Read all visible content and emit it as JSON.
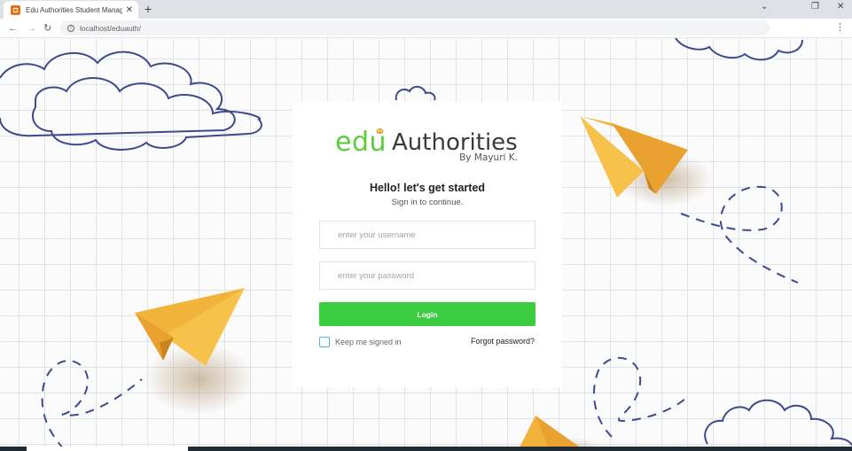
{
  "browser": {
    "tab_title": "Edu Authorities Student Manager",
    "url": "localhost/eduauth/",
    "new_tab_symbol": "+",
    "tab_close_symbol": "✕"
  },
  "brand": {
    "logo_edu": "edu",
    "logo_authorities": "Authorities",
    "logo_byline": "By Mayuri K.",
    "green": "#5dcc3a"
  },
  "login": {
    "heading": "Hello! let's get started",
    "subheading": "Sign in to continue.",
    "username_placeholder": "enter your username",
    "password_placeholder": "enter your password",
    "username_value": "",
    "password_value": "",
    "login_label": "Login",
    "remember_label": "Keep me signed in",
    "remember_checked": false,
    "forgot_label": "Forgot password?",
    "button_color": "#3ccc40"
  },
  "icons": {
    "back": "arrow-left-icon",
    "forward": "arrow-right-icon",
    "reload": "reload-icon",
    "info": "info-icon",
    "menu": "kebab-menu-icon",
    "plane": "paper-plane-icon",
    "cloud": "cloud-icon"
  }
}
